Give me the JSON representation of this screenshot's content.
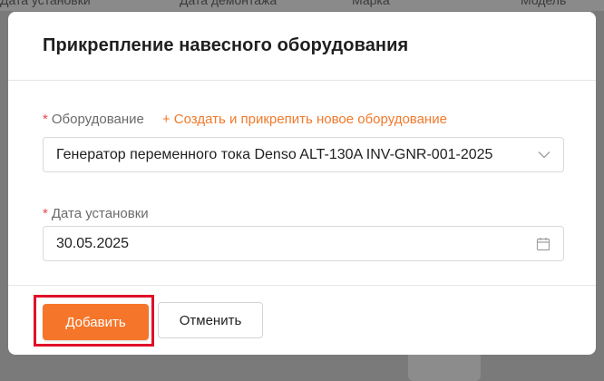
{
  "background": {
    "columns": [
      "Дата установки",
      "Дата демонтажа",
      "Марка",
      "Модель"
    ]
  },
  "modal": {
    "title": "Прикрепление навесного оборудования",
    "equipment": {
      "label": "Оборудование",
      "required_mark": "*",
      "create_link": "+ Создать и прикрепить новое оборудование",
      "value": "Генератор переменного тока Denso ALT-130A INV-GNR-001-2025"
    },
    "install_date": {
      "label": "Дата установки",
      "required_mark": "*",
      "value": "30.05.2025"
    },
    "buttons": {
      "add": "Добавить",
      "cancel": "Отменить"
    }
  },
  "colors": {
    "accent": "#f5762a",
    "link": "#f07a2c",
    "required": "#e5484d",
    "highlight": "#e0102a"
  },
  "icons": {
    "select": "chevron-down-icon",
    "date": "calendar-icon"
  }
}
